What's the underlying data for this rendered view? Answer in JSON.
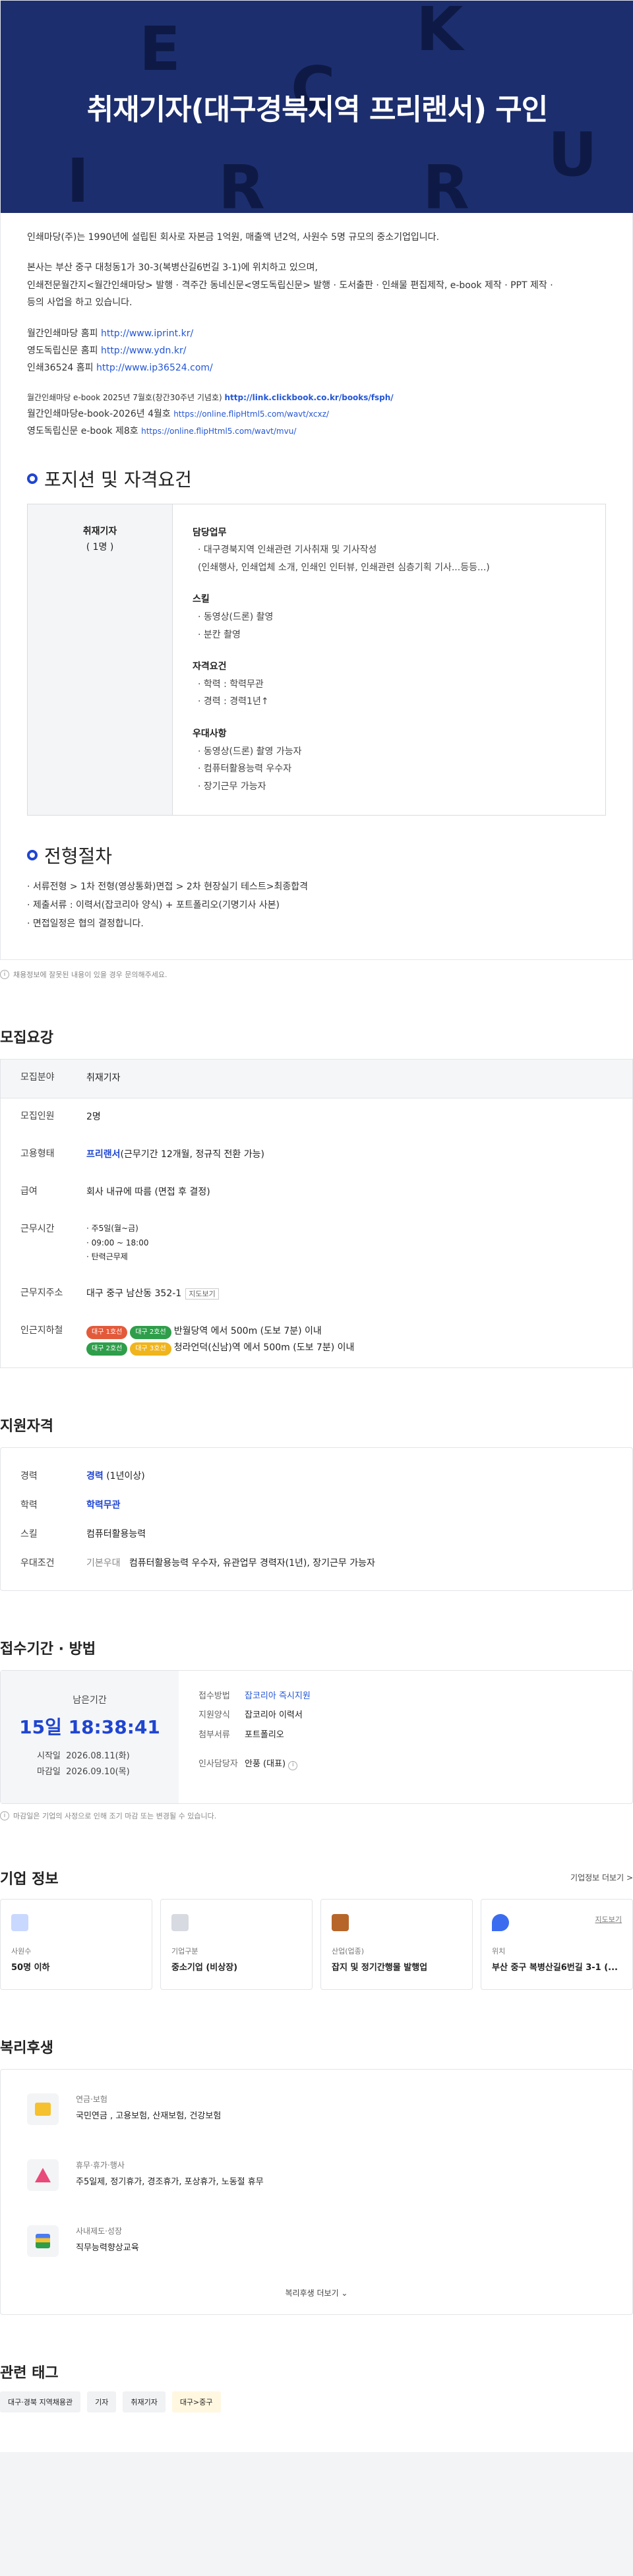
{
  "banner": {
    "title": "취재기자(대구경북지역 프리랜서) 구인",
    "deco_letters": [
      "E",
      "K",
      "C",
      "R",
      "U",
      "I",
      "R"
    ]
  },
  "intro": {
    "line1": "인쇄마당(주)는 1990년에 설립된 회사로 자본금 1억원, 매출액 년2억, 사원수 5명 규모의 중소기업입니다.",
    "line2": "본사는 부산 중구 대청동1가 30-3(복병산길6번길 3-1)에 위치하고 있으며,",
    "line3": "인쇄전문월간지<월간인쇄마당> 발행 · 격주간 동네신문<영도독립신문> 발행 · 도서출판 · 인쇄물 편집제작, e-book 제작 · PPT 제작 ·",
    "line4": "등의 사업을 하고 있습니다.",
    "link1_label": "월간인쇄마당 홈피",
    "link1_url": "http://www.iprint.kr/",
    "link2_label": "영도독립신문 홈피",
    "link2_url": "http://www.ydn.kr/",
    "link3_label": "인쇄36524 홈피",
    "link3_url": "http://www.ip36524.com/",
    "ebook1_label": "월간인쇄마당 e-book 2025년 7월호(창간30주년 기념호)",
    "ebook1_url": "http://link.clickbook.co.kr/books/fsph/",
    "ebook2_label": "월간인쇄마당e-book-2026년 4월호",
    "ebook2_url": "https://online.flipHtml5.com/wavt/xcxz/",
    "ebook3_label": "영도독립신문 e-book 제8호",
    "ebook3_url": "https://online.flipHtml5.com/wavt/mvu/"
  },
  "position": {
    "heading": "포지션 및 자격요건",
    "role": "취재기자",
    "count": "( 1명 )",
    "duty_title": "담당업무",
    "duties": [
      "· 대구경북지역 인쇄관련 기사취재 및 기사작성",
      "(인쇄행사, 인쇄업체 소개, 인쇄인 인터뷰, 인쇄관련 심층기획 기사...등등...)"
    ],
    "skill_title": "스킬",
    "skills": [
      "· 동영상(드론) 촬영",
      "· 분칸 촬영"
    ],
    "req_title": "자격요건",
    "reqs": [
      "· 학력 : 학력무관",
      "· 경력 : 경력1년↑"
    ],
    "pref_title": "우대사항",
    "prefs": [
      "· 동영상(드론) 촬영 가능자",
      "· 컴퓨터활용능력 우수자",
      "· 장기근무 가능자"
    ]
  },
  "process": {
    "heading": "전형절차",
    "items": [
      "· 서류전형 > 1차 전형(영상통화)면접 > 2차 현장실기 테스트>최종합격",
      "· 제출서류 : 이력서(잡코리아 양식) + 포트폴리오(기명기사 사본)",
      "· 면접일정은 협의 결정합니다."
    ]
  },
  "notice": "채용정보에 잘못된 내용이 있을 경우 문의해주세요.",
  "recruit": {
    "title": "모집요강",
    "field_k": "모집분야",
    "field_v": "취재기자",
    "count_k": "모집인원",
    "count_v": "2명",
    "type_k": "고용형태",
    "type_v1": "프리랜서",
    "type_v2": "(근무기간 12개월, 정규직 전환 가능)",
    "pay_k": "급여",
    "pay_v": "회사 내규에 따름 (면접 후 결정)",
    "time_k": "근무시간",
    "time_v": [
      "· 주5일(월~금)",
      "· 09:00 ~ 18:00",
      "· 탄력근무제"
    ],
    "addr_k": "근무지주소",
    "addr_v": "대구 중구 남산동 352-1",
    "map_label": "지도보기",
    "station_k": "인근지하철",
    "station1_lines": [
      "대구 1호선",
      "대구 2호선"
    ],
    "station1_v": "반월당역 에서 500m (도보 7분) 이내",
    "station2_lines": [
      "대구 2호선",
      "대구 3호선"
    ],
    "station2_v": "청라언덕(신남)역 에서 500m (도보 7분) 이내"
  },
  "qual": {
    "title": "지원자격",
    "exp_k": "경력",
    "exp_v1": "경력",
    "exp_v2": " (1년이상)",
    "edu_k": "학력",
    "edu_v": "학력무관",
    "skill_k": "스킬",
    "skill_v": "컴퓨터활용능력",
    "pref_k": "우대조건",
    "pref_tag": "기본우대",
    "pref_v": "컴퓨터활용능력 우수자, 유관업무 경력자(1년), 장기근무 가능자"
  },
  "apply": {
    "title": "접수기간 · 방법",
    "remain_label": "남은기간",
    "remain_value": "15일 18:38:41",
    "start_k": "시작일",
    "start_v": "2026.08.11(화)",
    "end_k": "마감일",
    "end_v": "2026.09.10(목)",
    "method_k": "접수방법",
    "method_v": "잡코리아 즉시지원",
    "form_k": "지원양식",
    "form_v": "잡코리아 이력서",
    "attach_k": "첨부서류",
    "attach_v": "포트폴리오",
    "hr_k": "인사담당자",
    "hr_v": "안풍 (대표)",
    "note": "마감일은 기업의 사정으로 인해 조기 마감 또는 변경될 수 있습니다."
  },
  "company": {
    "title": "기업 정보",
    "more": "기업정보 더보기 >",
    "items": [
      {
        "label": "사원수",
        "value": "50명 이하"
      },
      {
        "label": "기업구분",
        "value": "중소기업 (비상장)"
      },
      {
        "label": "산업(업종)",
        "value": "잡지 및 정기간행물 발행업"
      },
      {
        "label": "위치",
        "value": "부산 중구 복병산길6번길 3-1 (..."
      }
    ],
    "map_link": "지도보기"
  },
  "welfare": {
    "title": "복리후생",
    "items": [
      {
        "label": "연금·보험",
        "value": "국민연금 , 고용보험, 산재보험, 건강보험"
      },
      {
        "label": "휴무·휴가·행사",
        "value": "주5일제, 정기휴가, 경조휴가, 포상휴가, 노동절 휴무"
      },
      {
        "label": "사내제도·성장",
        "value": "직무능력향상교육"
      }
    ],
    "more": "복리후생 더보기 ⌄"
  },
  "tags": {
    "title": "관련 태그",
    "items": [
      "대구·경북 지역채용관",
      "기자",
      "취재기자",
      "대구>중구"
    ]
  }
}
